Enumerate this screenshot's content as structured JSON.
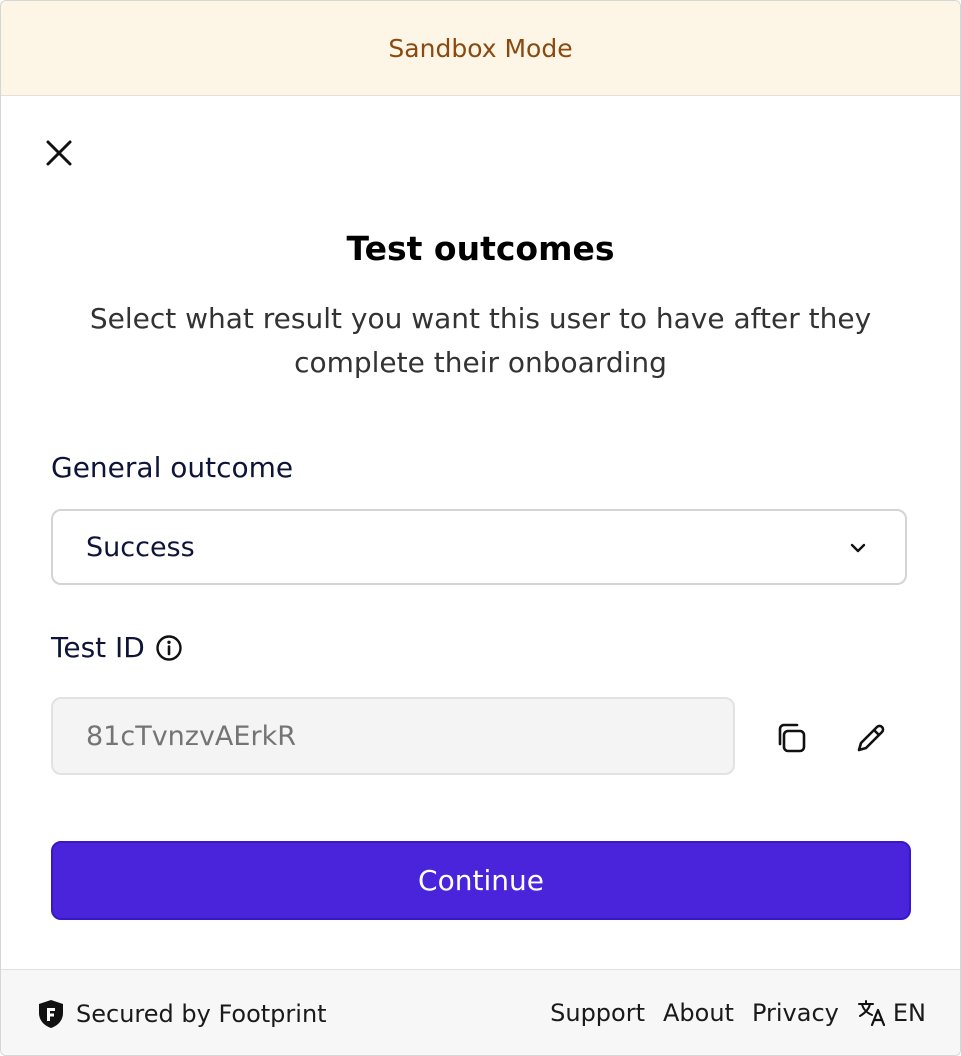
{
  "banner": {
    "text": "Sandbox Mode"
  },
  "dialog": {
    "title": "Test outcomes",
    "subtitle": "Select what result you want this user to have after they complete their onboarding",
    "general_outcome": {
      "label": "General outcome",
      "selected": "Success"
    },
    "test_id": {
      "label": "Test ID",
      "value": "81cTvnzvAErkR"
    },
    "continue_label": "Continue"
  },
  "footer": {
    "secured_text": "Secured by Footprint",
    "links": {
      "support": "Support",
      "about": "About",
      "privacy": "Privacy"
    },
    "language": "EN"
  },
  "colors": {
    "banner_bg": "#fdf5e6",
    "banner_text": "#8a4a0f",
    "primary": "#4a24db",
    "field_disabled_bg": "#f4f4f4"
  },
  "icons": [
    "close-icon",
    "chevron-down-icon",
    "info-icon",
    "copy-icon",
    "pencil-icon",
    "shield-icon",
    "translate-icon"
  ]
}
